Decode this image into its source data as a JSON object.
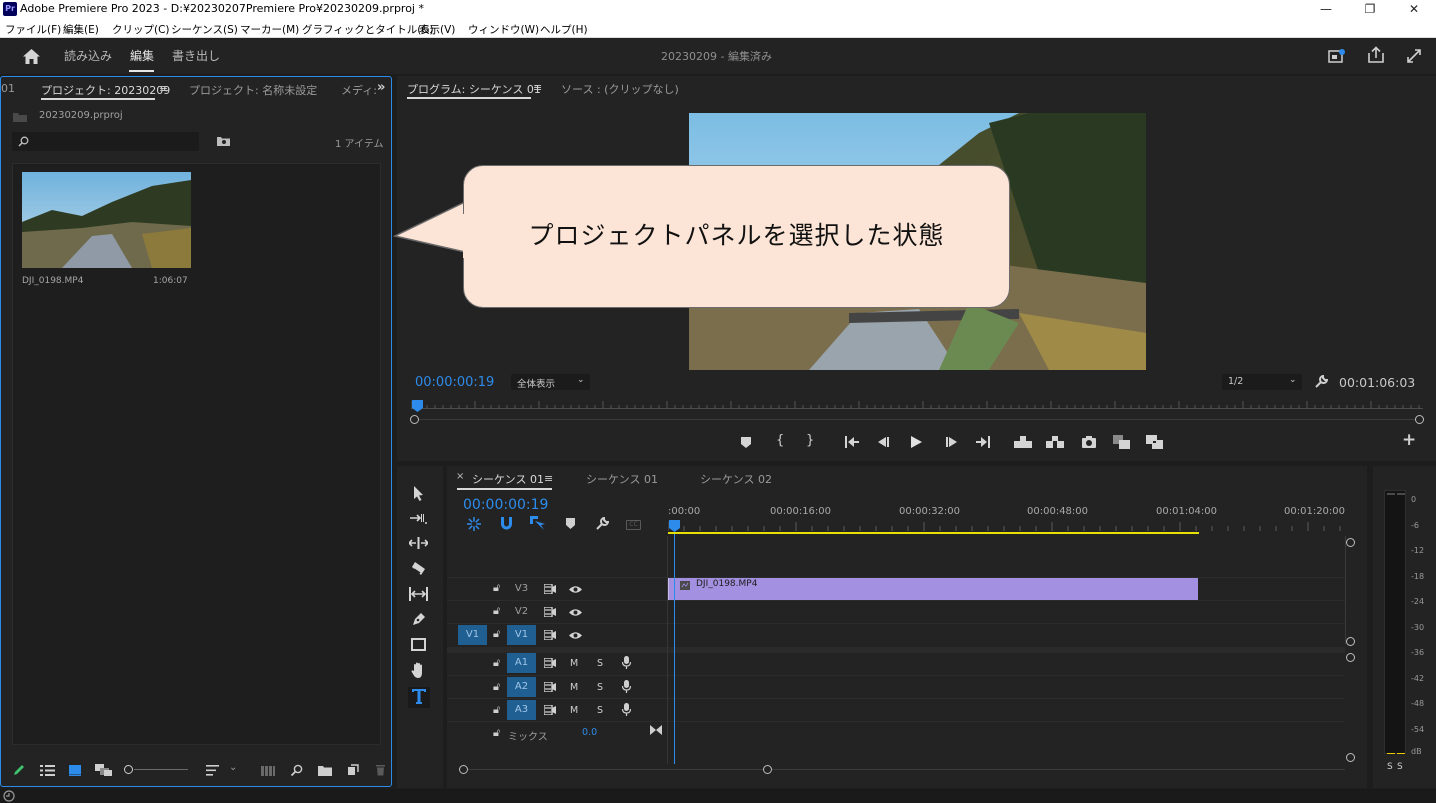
{
  "window": {
    "title": "Adobe Premiere Pro 2023 - D:¥20230207Premiere Pro¥20230209.prproj *",
    "app_icon_text": "Pr",
    "minimize": "—",
    "restore": "❐",
    "close": "✕"
  },
  "menu": [
    "ファイル(F)",
    "編集(E)",
    "クリップ(C)",
    "シーケンス(S)",
    "マーカー(M)",
    "グラフィックとタイトル(G)",
    "表示(V)",
    "ウィンドウ(W)",
    "ヘルプ(H)"
  ],
  "workspace": {
    "tabs": [
      "読み込み",
      "編集",
      "書き出し"
    ],
    "active_tab": "編集",
    "project_title": "20230209 - 編集済み"
  },
  "project_panel": {
    "left_edge_text": "01",
    "tabs": [
      "プロジェクト: 20230209",
      "プロジェクト: 名称未設定",
      "メディ:"
    ],
    "active_tab": "プロジェクト: 20230209",
    "file_name": "20230209.prproj",
    "search_placeholder": "",
    "item_count": "1 アイテム",
    "clip": {
      "name": "DJI_0198.MP4",
      "duration": "1:06:07"
    }
  },
  "program_monitor": {
    "tabs": [
      "プログラム: シーケンス 01",
      "ソース : (クリップなし)"
    ],
    "active_tab": "プログラム: シーケンス 01",
    "current_timecode": "00:00:00:19",
    "zoom_select": "全体表示",
    "resolution_select": "1/2",
    "duration_timecode": "00:01:06:03",
    "transport": [
      "marker-icon",
      "in-point-icon",
      "out-point-icon",
      "go-to-in-icon",
      "step-back-icon",
      "play-icon",
      "step-forward-icon",
      "go-to-out-icon",
      "lift-icon",
      "extract-icon",
      "export-frame-icon",
      "compare-icon",
      "overlay-icon"
    ]
  },
  "timeline": {
    "tabs": [
      "シーケンス 01",
      "シーケンス 01",
      "シーケンス 02"
    ],
    "active_tab": "シーケンス 01",
    "close_glyph": "×",
    "timecode": "00:00:00:19",
    "ruler_labels": [
      ":00:00",
      "00:00:16:00",
      "00:00:32:00",
      "00:00:48:00",
      "00:01:04:00",
      "00:01:20:00"
    ],
    "video_tracks": [
      "V3",
      "V2",
      "V1"
    ],
    "source_target": "V1",
    "audio_tracks": [
      "A1",
      "A2",
      "A3"
    ],
    "mute_label": "M",
    "solo_label": "S",
    "mix_label": "ミックス",
    "mix_value": "0.0",
    "clip": {
      "name": "DJI_0198.MP4",
      "color": "#a390e0"
    }
  },
  "audio_meter": {
    "scale": [
      "0",
      "-6",
      "-12",
      "-18",
      "-24",
      "-30",
      "-36",
      "-42",
      "-48",
      "-54",
      "dB"
    ],
    "solo_buttons": [
      "S",
      "S"
    ]
  },
  "annotation": {
    "text": "プロジェクトパネルを選択した状態"
  },
  "colors": {
    "accent_blue": "#2d8ceb",
    "selected_panel_border": "#2d8ceb",
    "work_area_bar": "#e7e000",
    "callout_fill": "#fce4d6"
  }
}
